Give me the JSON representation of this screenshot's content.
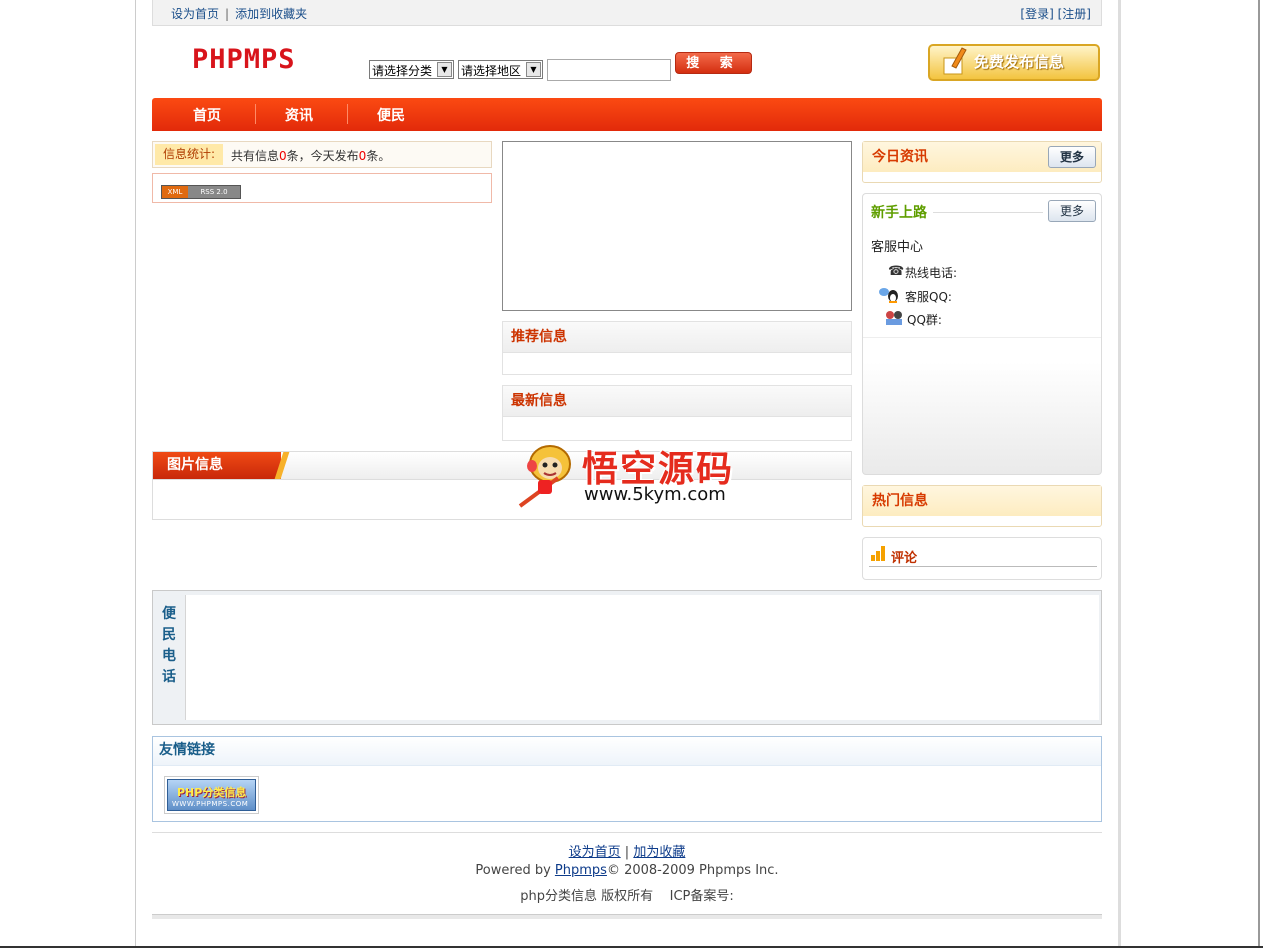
{
  "topbar": {
    "set_home": "设为首页",
    "separator": "|",
    "add_favorite": "添加到收藏夹",
    "login": "[登录]",
    "register": "[注册]"
  },
  "header": {
    "logo": "PHPMPS",
    "category_select": "请选择分类",
    "region_select": "请选择地区",
    "search_value": "",
    "search_button": "搜 索",
    "publish_button": "免费发布信息"
  },
  "nav": {
    "items": [
      {
        "label": "首页"
      },
      {
        "label": "资讯"
      },
      {
        "label": "便民"
      }
    ]
  },
  "stats": {
    "label": "信息统计:",
    "prefix": "共有信息",
    "total": "0",
    "middle": "条，今天发布",
    "today": "0",
    "suffix": "条。"
  },
  "rss": {
    "xml": "XML",
    "rss": "RSS 2.0"
  },
  "panels": {
    "recommended": "推荐信息",
    "latest": "最新信息",
    "pictures": "图片信息",
    "today_news": "今日资讯",
    "hot": "热门信息",
    "comments": "评论",
    "more": "更多"
  },
  "guide": {
    "title": "新手上路",
    "more": "更多",
    "service_center": "客服中心",
    "hotline": "热线电话:",
    "qq": "客服QQ:",
    "qq_group": "QQ群:"
  },
  "watermark": {
    "title": "悟空源码",
    "url": "www.5kym.com"
  },
  "phone": {
    "label": "便民电话"
  },
  "links": {
    "title": "友情链接",
    "logo_top": "PHP分类信息",
    "logo_bottom": "WWW.PHPMPS.COM"
  },
  "footer": {
    "set_home": "设为首页",
    "separator": "|",
    "add_favorite": "加为收藏",
    "powered_prefix": "Powered by ",
    "powered_link": "Phpmps",
    "copyright": "© 2008-2009 Phpmps Inc.",
    "rights": "php分类信息 版权所有",
    "icp": "ICP备案号:"
  },
  "colors": {
    "nav": "#f0380e",
    "accent_red": "#d8141b",
    "link_blue": "#1a4e8a"
  }
}
